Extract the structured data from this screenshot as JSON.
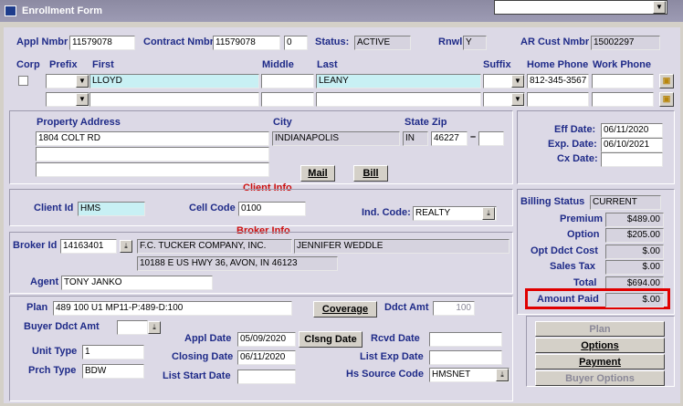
{
  "window": {
    "title": "Enrollment Form"
  },
  "header": {
    "appl_nmbr_label": "Appl Nmbr",
    "appl_nmbr": "11579078",
    "contract_nmbr_label": "Contract Nmbr",
    "contract_nmbr": "11579078",
    "contract_suffix": "0",
    "status_label": "Status:",
    "status": "ACTIVE",
    "rnwl_label": "Rnwl:",
    "rnwl": "Y",
    "ar_cust_label": "AR Cust Nmbr",
    "ar_cust": "15002297"
  },
  "name_row": {
    "corp_label": "Corp",
    "prefix_label": "Prefix",
    "first_label": "First",
    "middle_label": "Middle",
    "last_label": "Last",
    "suffix_label": "Suffix",
    "home_phone_label": "Home Phone",
    "work_phone_label": "Work Phone",
    "first": "LLOYD",
    "last": "LEANY",
    "home_phone": "812-345-3567"
  },
  "address": {
    "property_label": "Property Address",
    "city_label": "City",
    "state_zip_label": "State Zip",
    "line1": "1804 COLT RD",
    "city": "INDIANAPOLIS",
    "state": "IN",
    "zip": "46227",
    "mail_label": "Mail",
    "bill_label": "Bill"
  },
  "dates": {
    "eff_label": "Eff Date:",
    "eff": "06/11/2020",
    "exp_label": "Exp. Date:",
    "exp": "06/10/2021",
    "cx_label": "Cx Date:"
  },
  "client": {
    "section": "Client Info",
    "client_id_label": "Client Id",
    "client_id": "HMS",
    "cell_code_label": "Cell Code",
    "cell_code": "0100",
    "ind_code_label": "Ind. Code:",
    "ind_code": "REALTY"
  },
  "broker": {
    "section": "Broker Info",
    "broker_id_label": "Broker Id",
    "broker_id": "14163401",
    "company": "F.C. TUCKER COMPANY, INC.",
    "contact": "JENNIFER WEDDLE",
    "address": "10188 E US HWY 36, AVON, IN 46123",
    "agent_label": "Agent",
    "agent": "TONY JANKO"
  },
  "billing": {
    "status_label": "Billing Status",
    "status": "CURRENT",
    "premium_label": "Premium",
    "premium": "$489.00",
    "option_label": "Option",
    "option": "$205.00",
    "opt_ddct_label": "Opt Ddct Cost",
    "opt_ddct": "$.00",
    "sales_tax_label": "Sales Tax",
    "sales_tax": "$.00",
    "total_label": "Total",
    "total": "$694.00",
    "amount_paid_label": "Amount Paid",
    "amount_paid": "$.00"
  },
  "plan": {
    "plan_label": "Plan",
    "plan": "489 100 U1 MP11-P:489-D:100",
    "coverage_label": "Coverage",
    "ddct_amt_label": "Ddct Amt",
    "ddct_amt": "100",
    "buyer_ddct_label": "Buyer Ddct Amt",
    "appl_date_label": "Appl Date",
    "appl_date": "05/09/2020",
    "clsng_date_btn": "Clsng Date",
    "rcvd_date_label": "Rcvd Date",
    "unit_type_label": "Unit Type",
    "unit_type": "1",
    "closing_date_label": "Closing Date",
    "closing_date": "06/11/2020",
    "list_exp_label": "List Exp Date",
    "prch_type_label": "Prch Type",
    "prch_type": "BDW",
    "list_start_label": "List Start Date",
    "hs_source_label": "Hs Source Code",
    "hs_source": "HMSNET"
  },
  "side_buttons": {
    "plan": "Plan",
    "options": "Options",
    "payment": "Payment",
    "buyer_options": "Buyer Options"
  },
  "colors": {
    "label_blue": "#1e2a88",
    "section_red": "#cc1010",
    "field_cyan": "#c8f0f4",
    "highlight": "#e00000"
  }
}
